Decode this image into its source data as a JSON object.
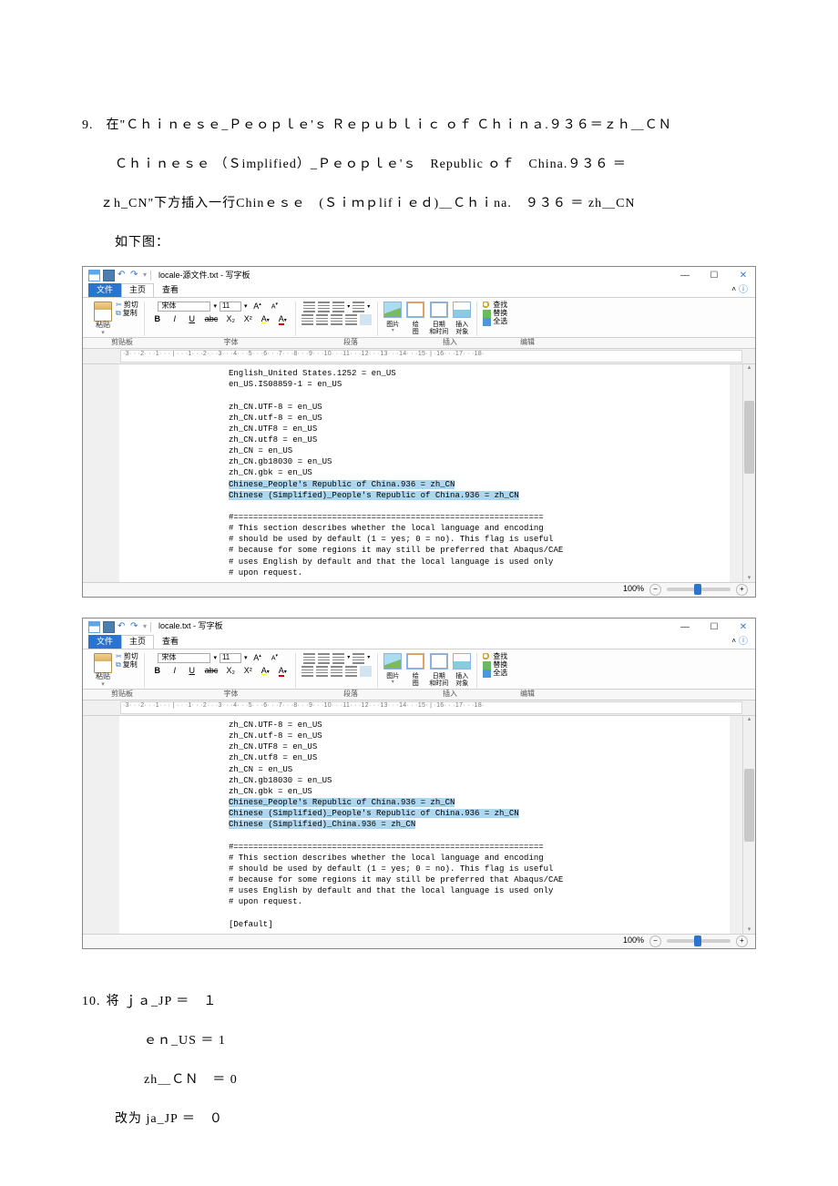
{
  "doc": {
    "item9_no": "9.",
    "item9_line1": "在\"Ｃｈｉｎｅｓｅ_Ｐｅｏｐｌｅ'ｓ Ｒｅｐｕｂｌｉｃ ｏｆ Ｃｈｉｎａ.９３６＝ｚｈ＿ＣＮ",
    "item9_line2": "Ｃｈｉｎｅｓｅ （Ｓimplified）_Ｐｅｏｐｌｅ'ｓ　Republic ｏｆ　China.９３６ ＝",
    "item9_line3": "ｚh_CN\"下方插入一行Chinｅｓｅ　(Ｓｉｍｐlifｉｅｄ)＿Ｃｈｉna.　９３６ ＝ zh＿CN",
    "item9_line4": "如下图：",
    "item10_no": "10.",
    "item10_line1": "将 ｊａ_JP ＝　１",
    "item10_line2": "ｅｎ_US ＝ 1",
    "item10_line3": "zh＿ＣＮ　＝ 0",
    "item10_line4": "改为 ja_JP ＝　０"
  },
  "wordpad_common": {
    "tab_file": "文件",
    "tab_home": "主页",
    "tab_view": "查看",
    "group_clipboard": "剪贴板",
    "group_font": "字体",
    "group_paragraph": "段落",
    "group_insert": "插入",
    "group_edit": "编辑",
    "cut": "剪切",
    "copy": "复制",
    "paste": "粘贴",
    "font_name": "宋体",
    "font_size": "11",
    "bold": "B",
    "italic": "I",
    "underline": "U",
    "strike": "abc",
    "sub": "X₂",
    "sup": "X²",
    "pencil": "A",
    "insert_pic": "图片",
    "insert_paint_l1": "绘",
    "insert_paint_l2": "图",
    "insert_date_l1": "日期",
    "insert_date_l2": "和时间",
    "insert_obj_l1": "插入",
    "insert_obj_l2": "对象",
    "find": "查找",
    "replace": "替换",
    "select_all": "全选",
    "zoom_label": "100%",
    "ruler_text": "·3· · ·2· · ·1· · · | · · ·1· · ·2· · ·3· · ·4· · ·5· · ·6· · ·7· · ·8· · ·9· · ·10· · ·11· · ·12· · ·13· · ·14· · ·15· | ·16· · ·17· · ·18·"
  },
  "wordpad1": {
    "title": "locale-源文件.txt - 写字板",
    "lines_plain_top": [
      "English_United States.1252 = en_US",
      "en_US.IS08859-1 = en_US",
      "",
      "zh_CN.UTF-8 = en_US",
      "zh_CN.utf-8 = en_US",
      "zh_CN.UTF8  = en_US",
      "zh_CN.utf8 = en_US",
      "zh_CN = en_US",
      "zh_CN.gb18030 = en_US",
      "zh_CN.gbk = en_US"
    ],
    "lines_hl": [
      "Chinese_People's Republic of China.936 = zh_CN",
      "Chinese (Simplified)_People's Republic of China.936 = zh_CN"
    ],
    "lines_plain_bot": [
      "",
      "#===============================================================",
      "# This section describes whether the local language and encoding",
      "# should be used by default (1 = yes; 0 = no).  This flag is useful",
      "# because for some regions it may still be preferred that Abaqus/CAE",
      "# uses English by default and that the local language is used only",
      "# upon request."
    ]
  },
  "wordpad2": {
    "title": "locale.txt - 写字板",
    "lines_plain_top": [
      "zh_CN.UTF-8 = en_US",
      "zh_CN.utf-8 = en_US",
      "zh_CN.UTF8  = en_US",
      "zh_CN.utf8 = en_US",
      "zh_CN = en_US",
      "zh_CN.gb18030 = en_US",
      "zh_CN.gbk = en_US"
    ],
    "lines_hl": [
      "Chinese_People's Republic of China.936 = zh_CN",
      "Chinese (Simplified)_People's Republic of China.936 = zh_CN",
      "Chinese (Simplified)_China.936 = zh_CN"
    ],
    "lines_plain_bot": [
      "",
      "#===============================================================",
      "# This section describes whether the local language and encoding",
      "# should be used by default (1 = yes; 0 = no).  This flag is useful",
      "# because for some regions it may still be preferred that Abaqus/CAE",
      "# uses English by default and that the local language is used only",
      "# upon request.",
      "",
      "[Default]"
    ]
  }
}
